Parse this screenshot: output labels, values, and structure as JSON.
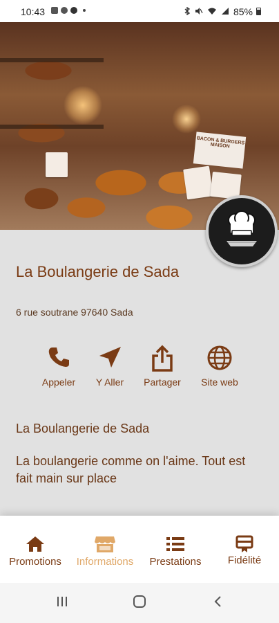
{
  "status_bar": {
    "time": "10:43",
    "battery": "85%",
    "icons": [
      "gallery-icon",
      "whatsapp-icon",
      "facebook-icon",
      "bluetooth-icon",
      "mute-icon",
      "wifi-icon",
      "signal-icon",
      "battery-icon"
    ]
  },
  "hero": {
    "image": "bakery-display-photo",
    "sign_text": "BACON & BURGERS MAISON"
  },
  "store": {
    "name": "La Boulangerie de Sada",
    "address": "6 rue soutrane 97640 Sada"
  },
  "actions": [
    {
      "label": "Appeler",
      "icon": "phone-icon"
    },
    {
      "label": "Y Aller",
      "icon": "navigation-arrow-icon"
    },
    {
      "label": "Partager",
      "icon": "share-icon"
    },
    {
      "label": "Site web",
      "icon": "globe-icon"
    }
  ],
  "description": {
    "title": "La Boulangerie de Sada",
    "text": "La boulangerie comme on l'aime. Tout est fait main sur place"
  },
  "bottom_nav": {
    "active": "Informations",
    "items": [
      {
        "label": "Promotions",
        "icon": "home-icon"
      },
      {
        "label": "Informations",
        "icon": "store-icon"
      },
      {
        "label": "Prestations",
        "icon": "list-icon"
      },
      {
        "label": "Fidélité",
        "icon": "loyalty-card-icon"
      }
    ]
  },
  "colors": {
    "primary": "#7a3b14",
    "active": "#e0a868",
    "background": "#e1e1e1"
  }
}
